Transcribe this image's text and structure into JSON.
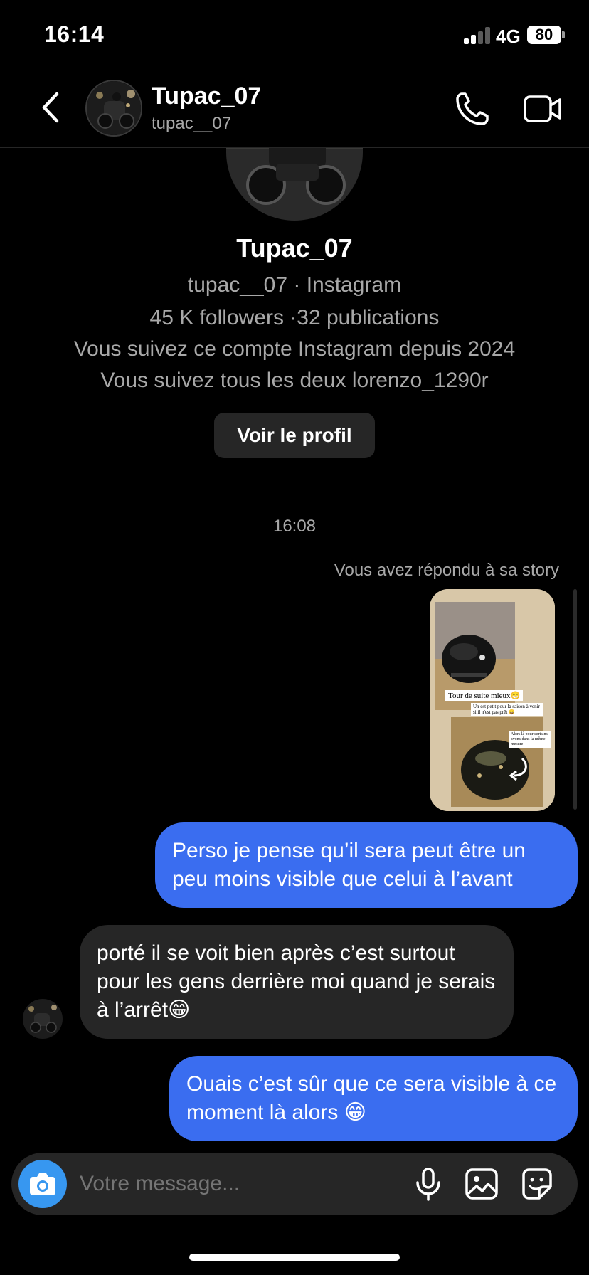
{
  "status_bar": {
    "time": "16:14",
    "network": "4G",
    "battery": "80"
  },
  "header": {
    "name": "Tupac_07",
    "username": "tupac__07"
  },
  "profile": {
    "name": "Tupac_07",
    "line1": "tupac__07 · Instagram",
    "line2": "45 K followers ·32 publications",
    "line3": "Vous suivez ce compte Instagram depuis 2024",
    "line4": "Vous suivez tous les deux lorenzo_1290r",
    "button": "Voir le profil"
  },
  "conversation": {
    "timestamp": "16:08",
    "story_reply_label": "Vous avez répondu à sa story",
    "story": {
      "caption1": "Tour de suite mieux😁",
      "caption2": "Un est petit pour la saison à venir si il n'est pas prêt 😀",
      "caption3": "Alors là pour certains avons dans la même mesure"
    },
    "messages": [
      {
        "from": "me",
        "text": "Perso je pense qu’il sera peut être un peu moins visible que celui à l’avant"
      },
      {
        "from": "them",
        "text": "porté il se voit bien après c’est surtout pour les gens derrière moi quand je serais à l’arrêt😁"
      },
      {
        "from": "me",
        "text": "Ouais c’est sûr que ce sera visible à ce moment là alors 😁"
      }
    ]
  },
  "composer": {
    "placeholder": "Votre message..."
  },
  "colors": {
    "outgoing_bubble": "#3a6df0",
    "incoming_bubble": "#262626",
    "camera_button": "#3797f0"
  }
}
